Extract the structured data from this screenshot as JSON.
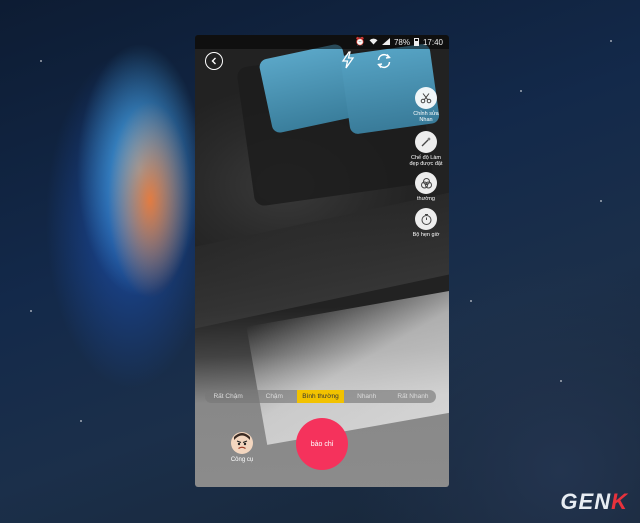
{
  "status_bar": {
    "battery": "78%",
    "time": "17:40"
  },
  "side_tools": [
    {
      "icon": "beauty-icon",
      "label": "Chỉnh sửa\nNhan"
    },
    {
      "icon": "magic-wand-icon",
      "label": "Chế độ Làm\nđẹp được đặt"
    },
    {
      "icon": "filter-icon",
      "label": "thường"
    },
    {
      "icon": "timer-icon",
      "label": "Bộ hẹn giờ"
    }
  ],
  "speed_options": [
    "Rất Chậm",
    "Chậm",
    "Bình thường",
    "Nhanh",
    "Rất Nhanh"
  ],
  "speed_selected": "Bình thường",
  "tools_label": "Công cụ",
  "record_label": "bảo chỉ",
  "watermark": {
    "prefix": "GEN",
    "suffix": "K"
  }
}
